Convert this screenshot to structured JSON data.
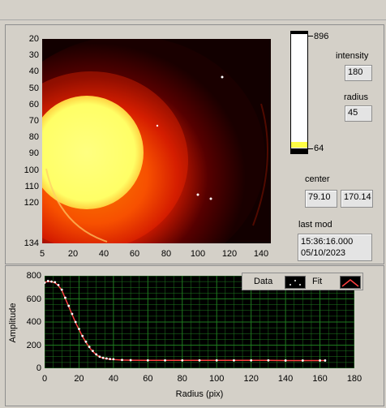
{
  "image_panel": {
    "y_ticks": [
      "20",
      "30",
      "40",
      "50",
      "60",
      "70",
      "80",
      "90",
      "100",
      "110",
      "120",
      "134"
    ],
    "x_ticks": [
      "5",
      "20",
      "40",
      "60",
      "80",
      "100",
      "120",
      "140"
    ]
  },
  "colorbar": {
    "max_label": "896",
    "min_label": "64"
  },
  "intensity": {
    "label": "intensity",
    "value": "180"
  },
  "radius": {
    "label": "radius",
    "value": "45"
  },
  "center": {
    "label": "center",
    "x": "79.10",
    "y": "170.14"
  },
  "last_mod": {
    "label": "last mod",
    "time": "15:36:16.000",
    "date": "05/10/2023"
  },
  "profile_plot": {
    "ylabel": "Amplitude",
    "xlabel": "Radius (pix)",
    "legend": {
      "data_label": "Data",
      "fit_label": "Fit"
    }
  },
  "chart_data": {
    "type": "scatter",
    "xlabel": "Radius (pix)",
    "ylabel": "Amplitude",
    "xlim": [
      0,
      180
    ],
    "ylim": [
      0,
      800
    ],
    "x_ticks": [
      0,
      20,
      40,
      60,
      80,
      100,
      120,
      140,
      160,
      180
    ],
    "y_ticks": [
      0,
      200,
      400,
      600,
      800
    ],
    "series": [
      {
        "name": "Data",
        "color": "#ffffff",
        "x": [
          0,
          2,
          4,
          6,
          8,
          10,
          12,
          14,
          16,
          18,
          20,
          22,
          24,
          26,
          28,
          30,
          32,
          34,
          36,
          38,
          40,
          45,
          50,
          60,
          70,
          80,
          90,
          100,
          110,
          120,
          130,
          140,
          150,
          160,
          163
        ],
        "y": [
          740,
          755,
          750,
          745,
          720,
          680,
          610,
          540,
          470,
          400,
          340,
          280,
          230,
          185,
          150,
          120,
          100,
          90,
          85,
          80,
          78,
          72,
          70,
          68,
          68,
          68,
          68,
          68,
          68,
          68,
          68,
          67,
          67,
          67,
          67
        ]
      },
      {
        "name": "Fit",
        "color": "#ff4040",
        "x": [
          0,
          2,
          4,
          6,
          8,
          10,
          12,
          14,
          16,
          18,
          20,
          22,
          24,
          26,
          28,
          30,
          32,
          34,
          36,
          38,
          40,
          45,
          50,
          60,
          70,
          80,
          90,
          100,
          110,
          120,
          130,
          140,
          150,
          160,
          163
        ],
        "y": [
          745,
          750,
          748,
          740,
          715,
          675,
          605,
          535,
          465,
          395,
          335,
          275,
          225,
          180,
          145,
          118,
          98,
          88,
          82,
          78,
          75,
          71,
          69,
          68,
          68,
          68,
          68,
          68,
          68,
          68,
          68,
          67,
          67,
          67,
          67
        ]
      }
    ]
  },
  "colors": {
    "panel": "#d4d0c8",
    "plot_bg": "#000000",
    "grid": "#1f7a1f",
    "fit": "#ff4040",
    "hot_core": "#ffff66"
  }
}
